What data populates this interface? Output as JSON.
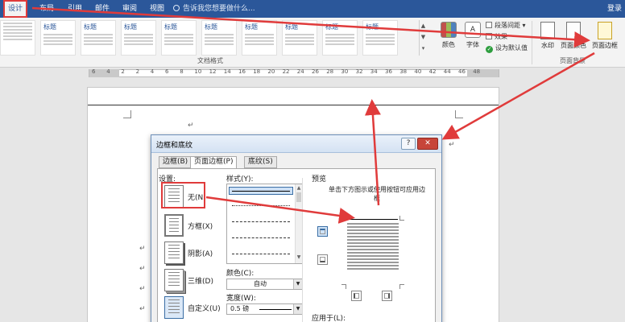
{
  "tabs": [
    {
      "id": "design",
      "label": "设计"
    },
    {
      "id": "layout",
      "label": "布局"
    },
    {
      "id": "references",
      "label": "引用"
    },
    {
      "id": "mailings",
      "label": "邮件"
    },
    {
      "id": "review",
      "label": "审阅"
    },
    {
      "id": "view",
      "label": "视图"
    }
  ],
  "tellme": "告诉我您想要做什么...",
  "login": "登录",
  "ribbon": {
    "style_title": "标题",
    "doc_format_label": "文档格式",
    "colors_label": "颜色",
    "fonts_label": "字体",
    "paragraph_spacing": "段落间距",
    "effects": "效果",
    "set_default": "设为默认值",
    "watermark": "水印",
    "page_color": "页面颜色",
    "page_borders": "页面边框",
    "page_background_label": "页面背景"
  },
  "ruler_numbers": [
    "6",
    "4",
    "2",
    "2",
    "4",
    "6",
    "8",
    "10",
    "12",
    "14",
    "16",
    "18",
    "20",
    "22",
    "24",
    "26",
    "28",
    "30",
    "32",
    "34",
    "36",
    "38",
    "40",
    "42",
    "44",
    "46",
    "48"
  ],
  "dialog": {
    "title": "边框和底纹",
    "help": "?",
    "close": "✕",
    "tabs": [
      "边框(B)",
      "页面边框(P)",
      "底纹(S)"
    ],
    "setting_label": "设置:",
    "options": [
      "无(N)",
      "方框(X)",
      "阴影(A)",
      "三维(D)",
      "自定义(U)"
    ],
    "style_label": "样式(Y):",
    "color_label": "颜色(C):",
    "color_value": "自动",
    "width_label": "宽度(W):",
    "width_value": "0.5 磅",
    "preview_label": "预览",
    "preview_hint": "单击下方图示或使用按钮可应用边框",
    "apply_label": "应用于(L):"
  },
  "colors": {
    "accent": "#2b579a",
    "annotation": "#e03b3b",
    "close": "#c7453a"
  }
}
